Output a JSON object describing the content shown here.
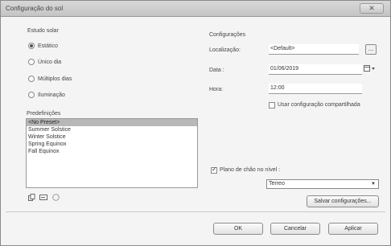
{
  "window": {
    "title": "Configuração do sol",
    "close_glyph": "✕"
  },
  "sun_study": {
    "label": "Estudo solar",
    "options": [
      {
        "label": "Estático",
        "checked": true
      },
      {
        "label": "Único dia",
        "checked": false
      },
      {
        "label": "Múltiplos dias",
        "checked": false
      },
      {
        "label": "Iluminação",
        "checked": false
      }
    ]
  },
  "presets": {
    "label": "Predefinições",
    "items": [
      {
        "label": "<No Preset>",
        "selected": true
      },
      {
        "label": "Summer Solstice",
        "selected": false
      },
      {
        "label": "Winter Solstice",
        "selected": false
      },
      {
        "label": "Spring Equinox",
        "selected": false
      },
      {
        "label": "Fall Equinox",
        "selected": false
      }
    ]
  },
  "settings": {
    "label": "Configurações",
    "location_label": "Localização:",
    "location_value": "<Default>",
    "browse_glyph": "...",
    "date_label": "Data :",
    "date_value": "01/06/2019",
    "time_label": "Hora:",
    "time_value": "12:00",
    "shared_checkbox_label": "Usar configuração compartilhada",
    "shared_checked": false,
    "ground_plane_label": "Plano de chão no nível :",
    "ground_plane_checked": true,
    "level_value": "Terreo",
    "save_button": "Salvar configurações..."
  },
  "buttons": {
    "ok": "OK",
    "cancel": "Cancelar",
    "apply": "Aplicar"
  },
  "icons": {
    "duplicate": "duplicate-icon",
    "rename": "rename-icon",
    "delete": "delete-icon"
  }
}
